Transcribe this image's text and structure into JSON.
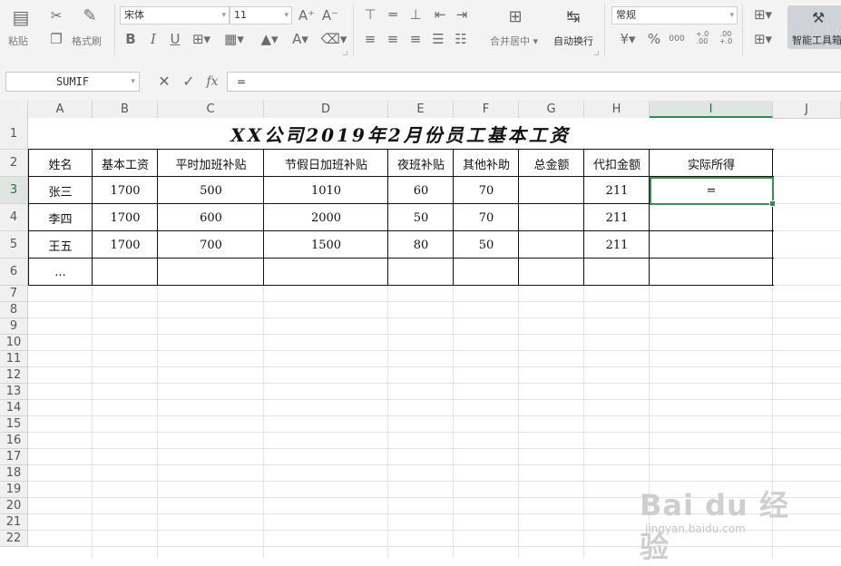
{
  "ribbon": {
    "paste": "粘贴",
    "format_painter": "格式刷",
    "font_name": "宋体",
    "font_size": "11",
    "merge_center": "合并居中",
    "wrap_text": "自动换行",
    "number_format": "常规",
    "smart_tools": "智能工具箱",
    "percent": "%",
    "thousands": "000",
    "inc_decimal": "+.0 .00",
    "dec_decimal": ".00 +.0"
  },
  "formula_bar": {
    "name_box": "SUMIF",
    "fx": "fx",
    "input": "="
  },
  "columns": [
    "A",
    "B",
    "C",
    "D",
    "E",
    "F",
    "G",
    "H",
    "I",
    "J"
  ],
  "rows": [
    "1",
    "2",
    "3",
    "4",
    "5",
    "6",
    "7",
    "8",
    "9",
    "10",
    "11",
    "12",
    "13",
    "14",
    "15",
    "16",
    "17",
    "18",
    "19",
    "20",
    "21",
    "22"
  ],
  "sheet": {
    "title": "XX公司2019年2月份员工基本工资",
    "headers": [
      "姓名",
      "基本工资",
      "平时加班补贴",
      "节假日加班补贴",
      "夜班补贴",
      "其他补助",
      "总金额",
      "代扣金额",
      "实际所得"
    ],
    "data": [
      [
        "张三",
        "1700",
        "500",
        "1010",
        "60",
        "70",
        "",
        "211",
        "="
      ],
      [
        "李四",
        "1700",
        "600",
        "2000",
        "50",
        "70",
        "",
        "211",
        ""
      ],
      [
        "王五",
        "1700",
        "700",
        "1500",
        "80",
        "50",
        "",
        "211",
        ""
      ],
      [
        "...",
        "",
        "",
        "",
        "",
        "",
        "",
        "",
        ""
      ]
    ]
  },
  "watermark": {
    "brand": "Bai du 经验",
    "url": "jingyan.baidu.com"
  },
  "colors": {
    "accent": "#217346",
    "selection": "#3a8e4c"
  }
}
